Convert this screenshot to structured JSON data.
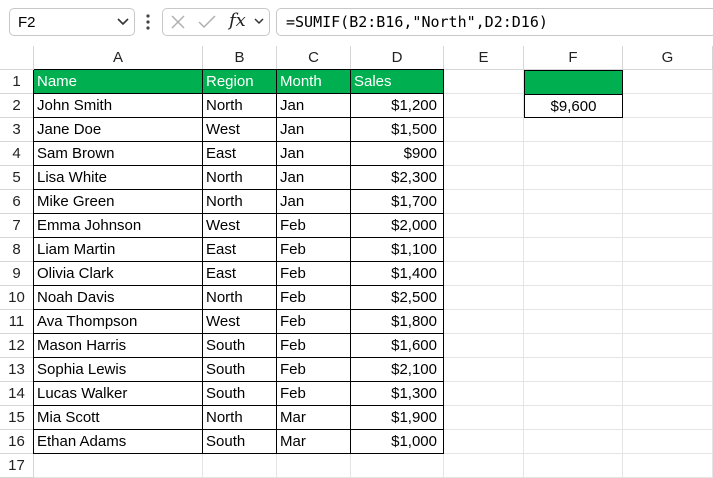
{
  "name_box": "F2",
  "formula": "=SUMIF(B2:B16,\"North\",D2:D16)",
  "fx_label": "fx",
  "columns": [
    "A",
    "B",
    "C",
    "D",
    "E",
    "F",
    "G"
  ],
  "rows": [
    "1",
    "2",
    "3",
    "4",
    "5",
    "6",
    "7",
    "8",
    "9",
    "10",
    "11",
    "12",
    "13",
    "14",
    "15",
    "16",
    "17"
  ],
  "table": {
    "headers": [
      "Name",
      "Region",
      "Month",
      "Sales"
    ],
    "rows": [
      [
        "John Smith",
        "North",
        "Jan",
        "$1,200"
      ],
      [
        "Jane Doe",
        "West",
        "Jan",
        "$1,500"
      ],
      [
        "Sam Brown",
        "East",
        "Jan",
        "$900"
      ],
      [
        "Lisa White",
        "North",
        "Jan",
        "$2,300"
      ],
      [
        "Mike Green",
        "North",
        "Jan",
        "$1,700"
      ],
      [
        "Emma Johnson",
        "West",
        "Feb",
        "$2,000"
      ],
      [
        "Liam Martin",
        "East",
        "Feb",
        "$1,100"
      ],
      [
        "Olivia Clark",
        "East",
        "Feb",
        "$1,400"
      ],
      [
        "Noah Davis",
        "North",
        "Feb",
        "$2,500"
      ],
      [
        "Ava Thompson",
        "West",
        "Feb",
        "$1,800"
      ],
      [
        "Mason Harris",
        "South",
        "Feb",
        "$1,600"
      ],
      [
        "Sophia Lewis",
        "South",
        "Feb",
        "$2,100"
      ],
      [
        "Lucas Walker",
        "South",
        "Feb",
        "$1,300"
      ],
      [
        "Mia Scott",
        "North",
        "Mar",
        "$1,900"
      ],
      [
        "Ethan Adams",
        "South",
        "Mar",
        "$1,000"
      ]
    ]
  },
  "result": {
    "header": "",
    "value": "$9,600"
  },
  "colors": {
    "header_fill": "#00b050",
    "header_text": "#ffffff"
  },
  "icons": [
    "chevron-down-icon",
    "more-vertical-icon",
    "cancel-icon",
    "enter-check-icon",
    "insert-function-icon"
  ]
}
